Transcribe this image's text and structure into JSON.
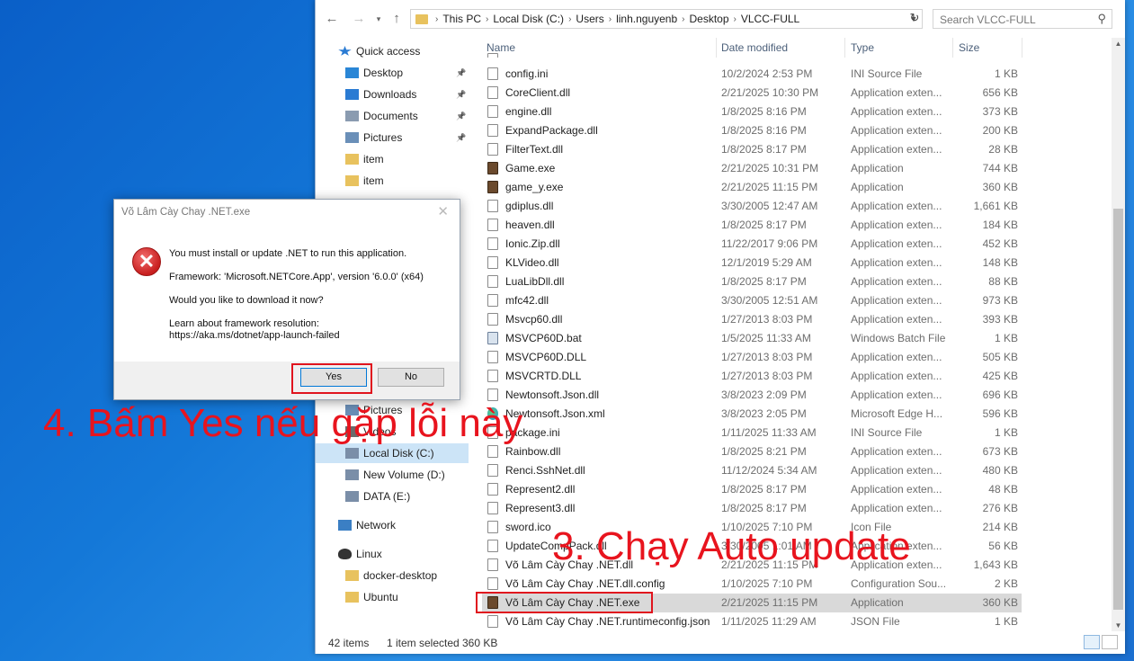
{
  "address": {
    "crumbs": [
      "This PC",
      "Local Disk (C:)",
      "Users",
      "linh.nguyenb",
      "Desktop",
      "VLCC-FULL"
    ],
    "search_placeholder": "Search VLCC-FULL"
  },
  "sidebar": {
    "items": [
      {
        "label": "Quick access",
        "icon": "star-icon",
        "pinned": false
      },
      {
        "label": "Desktop",
        "icon": "desktop-icon",
        "pinned": true
      },
      {
        "label": "Downloads",
        "icon": "download-icon",
        "pinned": true
      },
      {
        "label": "Documents",
        "icon": "documents-icon",
        "pinned": true
      },
      {
        "label": "Pictures",
        "icon": "pictures-icon",
        "pinned": true
      },
      {
        "label": "item",
        "icon": "folder-icon",
        "pinned": false
      },
      {
        "label": "item",
        "icon": "folder-icon",
        "pinned": false
      },
      {
        "label": "Music",
        "icon": "music-icon",
        "pinned": false
      },
      {
        "label": "Pictures",
        "icon": "pictures-icon",
        "pinned": false
      },
      {
        "label": "Videos",
        "icon": "videos-icon",
        "pinned": false
      },
      {
        "label": "Local Disk (C:)",
        "icon": "drive-icon",
        "pinned": false
      },
      {
        "label": "New Volume (D:)",
        "icon": "drive-icon",
        "pinned": false
      },
      {
        "label": "DATA (E:)",
        "icon": "drive-icon",
        "pinned": false
      },
      {
        "label": "Network",
        "icon": "network-icon",
        "pinned": false
      },
      {
        "label": "Linux",
        "icon": "linux-icon",
        "pinned": false
      },
      {
        "label": "docker-desktop",
        "icon": "folder-icon",
        "pinned": false
      },
      {
        "label": "Ubuntu",
        "icon": "folder-icon",
        "pinned": false
      }
    ]
  },
  "columns": {
    "name": "Name",
    "date": "Date modified",
    "type": "Type",
    "size": "Size"
  },
  "files": [
    {
      "name": "config.ini",
      "date": "10/2/2024 2:53 PM",
      "type": "INI Source File",
      "size": "1 KB",
      "icon": "ini"
    },
    {
      "name": "CoreClient.dll",
      "date": "2/21/2025 10:30 PM",
      "type": "Application exten...",
      "size": "656 KB",
      "icon": "dll"
    },
    {
      "name": "engine.dll",
      "date": "1/8/2025 8:16 PM",
      "type": "Application exten...",
      "size": "373 KB",
      "icon": "dll"
    },
    {
      "name": "ExpandPackage.dll",
      "date": "1/8/2025 8:16 PM",
      "type": "Application exten...",
      "size": "200 KB",
      "icon": "dll"
    },
    {
      "name": "FilterText.dll",
      "date": "1/8/2025 8:17 PM",
      "type": "Application exten...",
      "size": "28 KB",
      "icon": "dll"
    },
    {
      "name": "Game.exe",
      "date": "2/21/2025 10:31 PM",
      "type": "Application",
      "size": "744 KB",
      "icon": "exe"
    },
    {
      "name": "game_y.exe",
      "date": "2/21/2025 11:15 PM",
      "type": "Application",
      "size": "360 KB",
      "icon": "exe"
    },
    {
      "name": "gdiplus.dll",
      "date": "3/30/2005 12:47 AM",
      "type": "Application exten...",
      "size": "1,661 KB",
      "icon": "dll"
    },
    {
      "name": "heaven.dll",
      "date": "1/8/2025 8:17 PM",
      "type": "Application exten...",
      "size": "184 KB",
      "icon": "dll"
    },
    {
      "name": "Ionic.Zip.dll",
      "date": "11/22/2017 9:06 PM",
      "type": "Application exten...",
      "size": "452 KB",
      "icon": "dll"
    },
    {
      "name": "KLVideo.dll",
      "date": "12/1/2019 5:29 AM",
      "type": "Application exten...",
      "size": "148 KB",
      "icon": "dll"
    },
    {
      "name": "LuaLibDll.dll",
      "date": "1/8/2025 8:17 PM",
      "type": "Application exten...",
      "size": "88 KB",
      "icon": "dll"
    },
    {
      "name": "mfc42.dll",
      "date": "3/30/2005 12:51 AM",
      "type": "Application exten...",
      "size": "973 KB",
      "icon": "dll"
    },
    {
      "name": "Msvcp60.dll",
      "date": "1/27/2013 8:03 PM",
      "type": "Application exten...",
      "size": "393 KB",
      "icon": "dll"
    },
    {
      "name": "MSVCP60D.bat",
      "date": "1/5/2025 11:33 AM",
      "type": "Windows Batch File",
      "size": "1 KB",
      "icon": "bat"
    },
    {
      "name": "MSVCP60D.DLL",
      "date": "1/27/2013 8:03 PM",
      "type": "Application exten...",
      "size": "505 KB",
      "icon": "dll"
    },
    {
      "name": "MSVCRTD.DLL",
      "date": "1/27/2013 8:03 PM",
      "type": "Application exten...",
      "size": "425 KB",
      "icon": "dll"
    },
    {
      "name": "Newtonsoft.Json.dll",
      "date": "3/8/2023 2:09 PM",
      "type": "Application exten...",
      "size": "696 KB",
      "icon": "dll"
    },
    {
      "name": "Newtonsoft.Json.xml",
      "date": "3/8/2023 2:05 PM",
      "type": "Microsoft Edge H...",
      "size": "596 KB",
      "icon": "edge"
    },
    {
      "name": "package.ini",
      "date": "1/11/2025 11:33 AM",
      "type": "INI Source File",
      "size": "1 KB",
      "icon": "ini"
    },
    {
      "name": "Rainbow.dll",
      "date": "1/8/2025 8:21 PM",
      "type": "Application exten...",
      "size": "673 KB",
      "icon": "dll"
    },
    {
      "name": "Renci.SshNet.dll",
      "date": "11/12/2024 5:34 AM",
      "type": "Application exten...",
      "size": "480 KB",
      "icon": "dll"
    },
    {
      "name": "Represent2.dll",
      "date": "1/8/2025 8:17 PM",
      "type": "Application exten...",
      "size": "48 KB",
      "icon": "dll"
    },
    {
      "name": "Represent3.dll",
      "date": "1/8/2025 8:17 PM",
      "type": "Application exten...",
      "size": "276 KB",
      "icon": "dll"
    },
    {
      "name": "sword.ico",
      "date": "1/10/2025 7:10 PM",
      "type": "Icon File",
      "size": "214 KB",
      "icon": "ico"
    },
    {
      "name": "UpdateCompPack.dll",
      "date": "3/30/2005 1:01 AM",
      "type": "Application exten...",
      "size": "56 KB",
      "icon": "dll"
    },
    {
      "name": "Võ Lâm Cày Chay .NET.dll",
      "date": "2/21/2025 11:15 PM",
      "type": "Application exten...",
      "size": "1,643 KB",
      "icon": "dll"
    },
    {
      "name": "Võ Lâm Cày Chay .NET.dll.config",
      "date": "1/10/2025 7:10 PM",
      "type": "Configuration Sou...",
      "size": "2 KB",
      "icon": "ini"
    },
    {
      "name": "Võ Lâm Cày Chay .NET.exe",
      "date": "2/21/2025 11:15 PM",
      "type": "Application",
      "size": "360 KB",
      "icon": "exe",
      "selected": true
    },
    {
      "name": "Võ Lâm Cày Chay .NET.runtimeconfig.json",
      "date": "1/11/2025 11:29 AM",
      "type": "JSON File",
      "size": "1 KB",
      "icon": "json"
    }
  ],
  "status": {
    "count": "42 items",
    "selection": "1 item selected",
    "size": "360 KB"
  },
  "dialog": {
    "title": "Võ Lâm Cày Chay .NET.exe",
    "line1": "You must install or update .NET to run this application.",
    "line2": "Framework: 'Microsoft.NETCore.App', version '6.0.0' (x64)",
    "line3": "Would you like to download it now?",
    "line4": "Learn about framework resolution:",
    "line5": "https://aka.ms/dotnet/app-launch-failed",
    "yes_label": "Yes",
    "no_label": "No"
  },
  "annotations": {
    "step4": "4. Bấm Yes nếu gặp lỗi này",
    "step3": "3. Chạy Auto update",
    "color": "#e8141e"
  }
}
